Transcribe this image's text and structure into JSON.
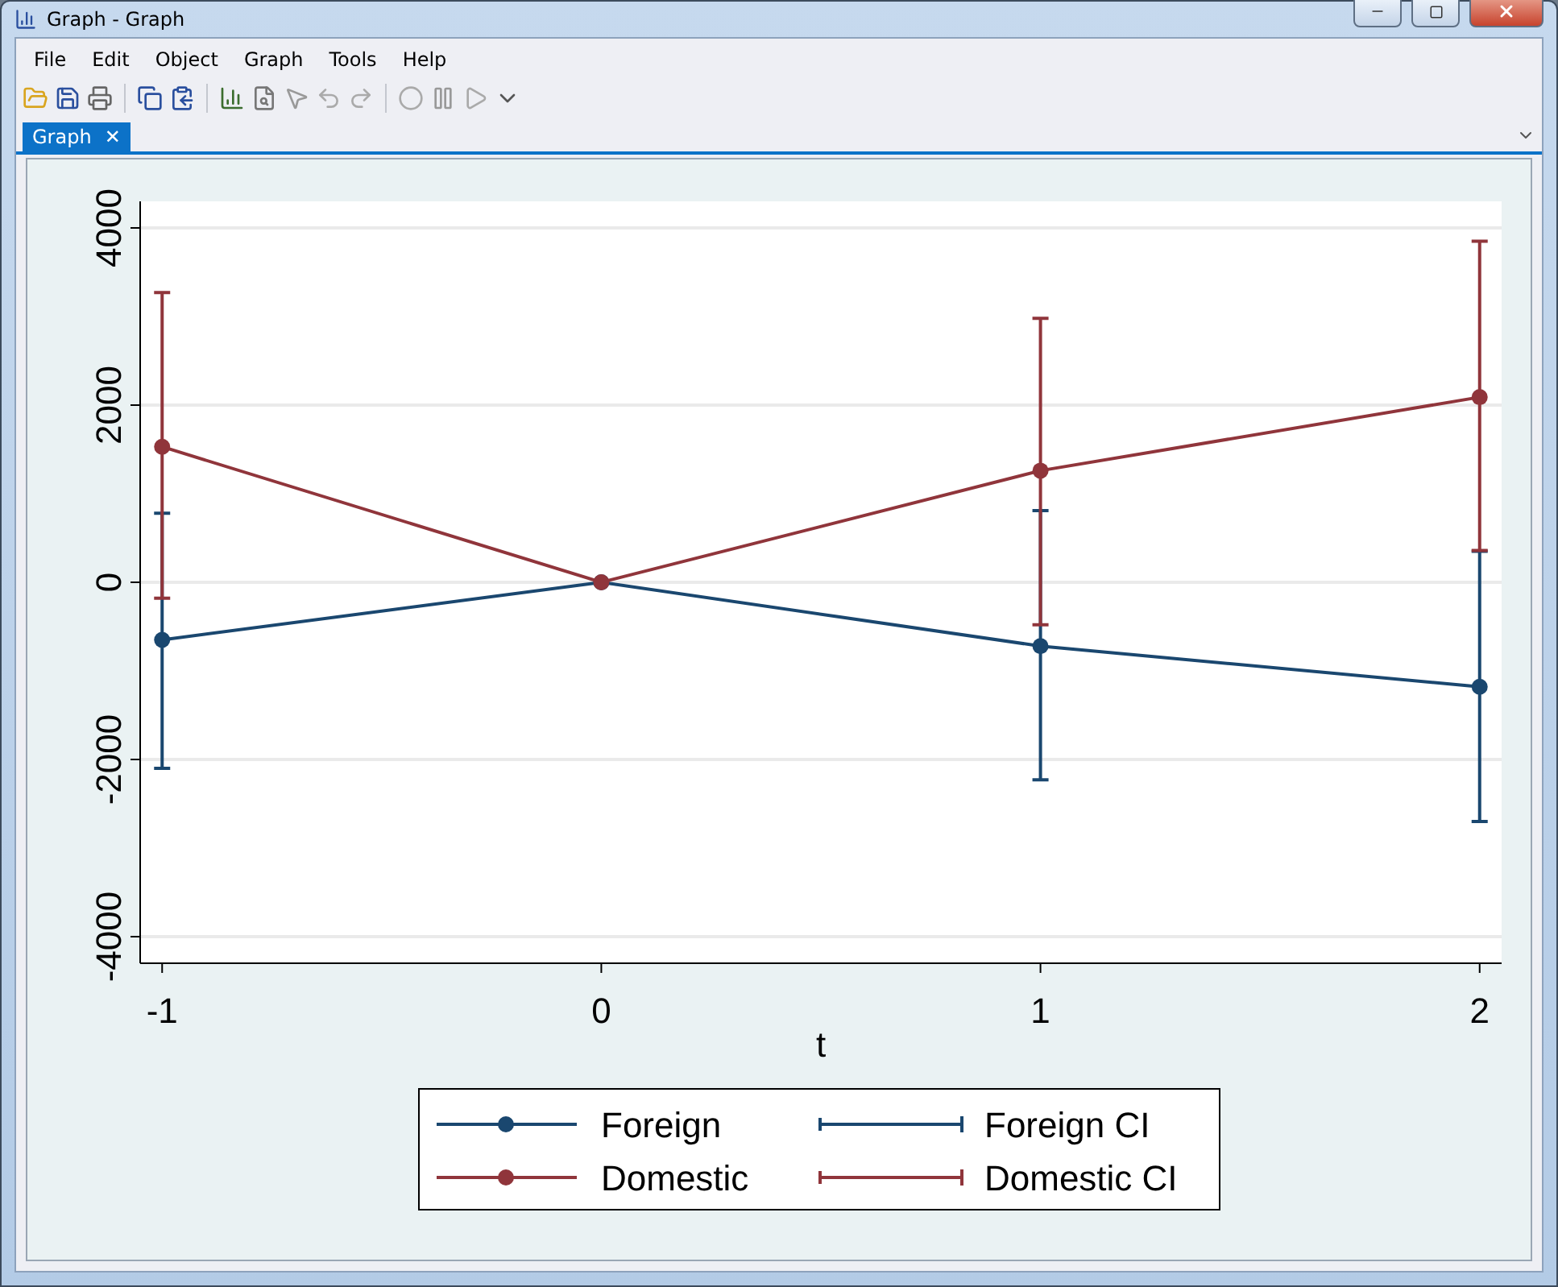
{
  "window": {
    "title": "Graph - Graph"
  },
  "menu": [
    "File",
    "Edit",
    "Object",
    "Graph",
    "Tools",
    "Help"
  ],
  "tabs": [
    {
      "label": "Graph",
      "selected": true,
      "close": "✕"
    }
  ],
  "graph": {
    "chart_data": {
      "type": "line",
      "xlabel": "t",
      "x": [
        -1,
        0,
        1,
        2
      ],
      "xlim": [
        -1.05,
        2.05
      ],
      "ylim": [
        -4300,
        4300
      ],
      "xticks": [
        -1,
        0,
        1,
        2
      ],
      "yticks": [
        -4000,
        -2000,
        0,
        2000,
        4000
      ],
      "grid": true,
      "legend": true,
      "series": [
        {
          "name": "Foreign",
          "color": "#1a476f",
          "marker": "circle",
          "values": [
            -650,
            0,
            -720,
            -1180
          ],
          "errors": [
            [
              -2100,
              780
            ],
            [
              0,
              0
            ],
            [
              -2230,
              810
            ],
            [
              -2700,
              350
            ]
          ]
        },
        {
          "name": "Domestic",
          "color": "#90353b",
          "marker": "circle",
          "values": [
            1530,
            0,
            1260,
            2090
          ],
          "errors": [
            [
              -180,
              3270
            ],
            [
              0,
              0
            ],
            [
              -480,
              2980
            ],
            [
              360,
              3850
            ]
          ]
        }
      ]
    },
    "ci_legend_labels": [
      "Foreign CI",
      "Domestic CI"
    ]
  }
}
